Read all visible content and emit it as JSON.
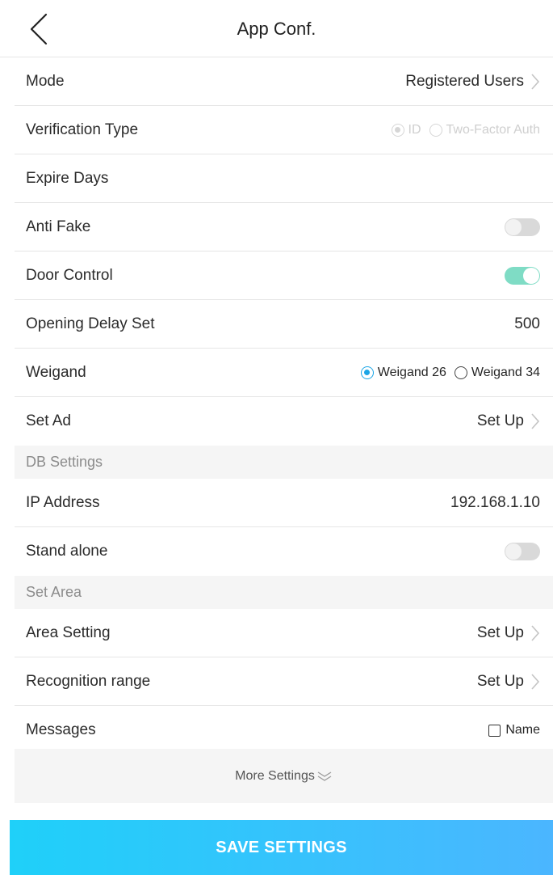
{
  "header": {
    "title": "App Conf."
  },
  "rows": {
    "mode": {
      "label": "Mode",
      "value": "Registered Users"
    },
    "verification": {
      "label": "Verification Type",
      "options": [
        "ID",
        "Two-Factor Auth"
      ],
      "selected": "ID",
      "disabled": true
    },
    "expire": {
      "label": "Expire Days",
      "value": ""
    },
    "anti_fake": {
      "label": "Anti Fake",
      "on": false
    },
    "door_control": {
      "label": "Door Control",
      "on": true
    },
    "opening_delay": {
      "label": "Opening Delay Set",
      "value": "500"
    },
    "weigand": {
      "label": "Weigand",
      "options": [
        "Weigand 26",
        "Weigand 34"
      ],
      "selected": "Weigand 26"
    },
    "set_ad": {
      "label": "Set Ad",
      "value": "Set Up"
    },
    "ip_address": {
      "label": "IP Address",
      "value": "192.168.1.10"
    },
    "stand_alone": {
      "label": "Stand alone",
      "on": false
    },
    "area_setting": {
      "label": "Area Setting",
      "value": "Set Up"
    },
    "recognition_range": {
      "label": "Recognition range",
      "value": "Set Up"
    },
    "messages": {
      "label": "Messages",
      "checkbox_label": "Name",
      "checked": false
    }
  },
  "sections": {
    "db": "DB Settings",
    "area": "Set Area"
  },
  "more_settings": "More Settings",
  "save_button": "SAVE SETTINGS",
  "colors": {
    "accent": "#1aa5e6",
    "toggle_on": "#7fdcc5",
    "toggle_off": "#d9d9d9",
    "button_start": "#1fd0f9",
    "button_end": "#4bb6ff"
  },
  "icons": {
    "back": "chevron-left-icon",
    "row_arrow": "chevron-right-icon",
    "more": "double-chevron-down-icon"
  }
}
